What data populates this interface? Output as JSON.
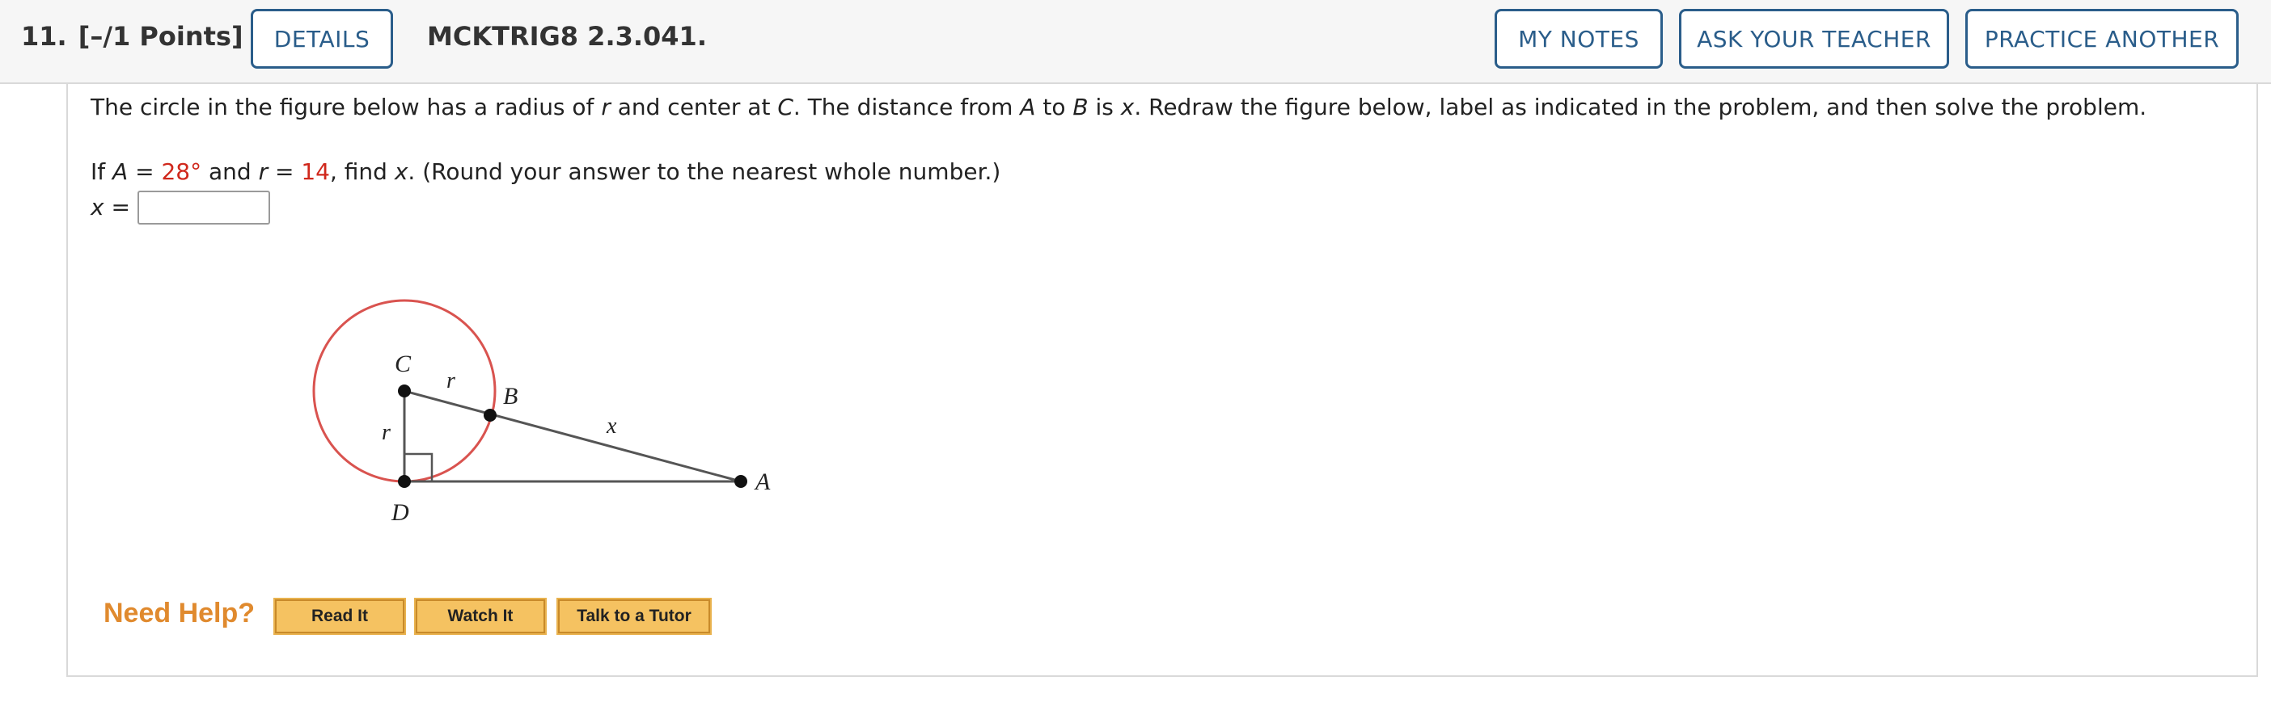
{
  "header": {
    "question_number": "11.",
    "points": "[–/1 Points]",
    "details_label": "DETAILS",
    "problem_code": "MCKTRIG8 2.3.041.",
    "my_notes_label": "MY NOTES",
    "ask_teacher_label": "ASK YOUR TEACHER",
    "practice_another_label": "PRACTICE ANOTHER"
  },
  "question": {
    "p1_a": "The circle in the figure below has a radius of ",
    "p1_r": "r",
    "p1_b": " and center at ",
    "p1_c": "C",
    "p1_d": ". The distance from ",
    "p1_A": "A",
    "p1_e": " to ",
    "p1_B": "B",
    "p1_f": " is ",
    "p1_x": "x",
    "p1_g": ". Redraw the figure below, label as indicated in the problem, and then solve the problem.",
    "p2_a": "If ",
    "p2_A": "A",
    "p2_eq1": " = ",
    "A_value": "28°",
    "p2_and": " and ",
    "p2_r": "r",
    "p2_eq2": " = ",
    "r_value": "14",
    "p2_find": ", find ",
    "p2_x": "x",
    "p2_tail": ". (Round your answer to the nearest whole number.)",
    "answer_var": "x",
    "answer_eq": " =",
    "answer_value": ""
  },
  "figure": {
    "label_C": "C",
    "label_B": "B",
    "label_D": "D",
    "label_A": "A",
    "label_r_top": "r",
    "label_r_left": "r",
    "label_x": "x",
    "circle_color": "#d9534f",
    "line_color": "#555555"
  },
  "help": {
    "title": "Need Help?",
    "read_label": "Read It",
    "watch_label": "Watch It",
    "tutor_label": "Talk to a Tutor"
  },
  "colors": {
    "accent": "#2a5d8a",
    "value_red": "#d0281c",
    "help_orange": "#e08a2e",
    "help_button": "#f5c261"
  }
}
